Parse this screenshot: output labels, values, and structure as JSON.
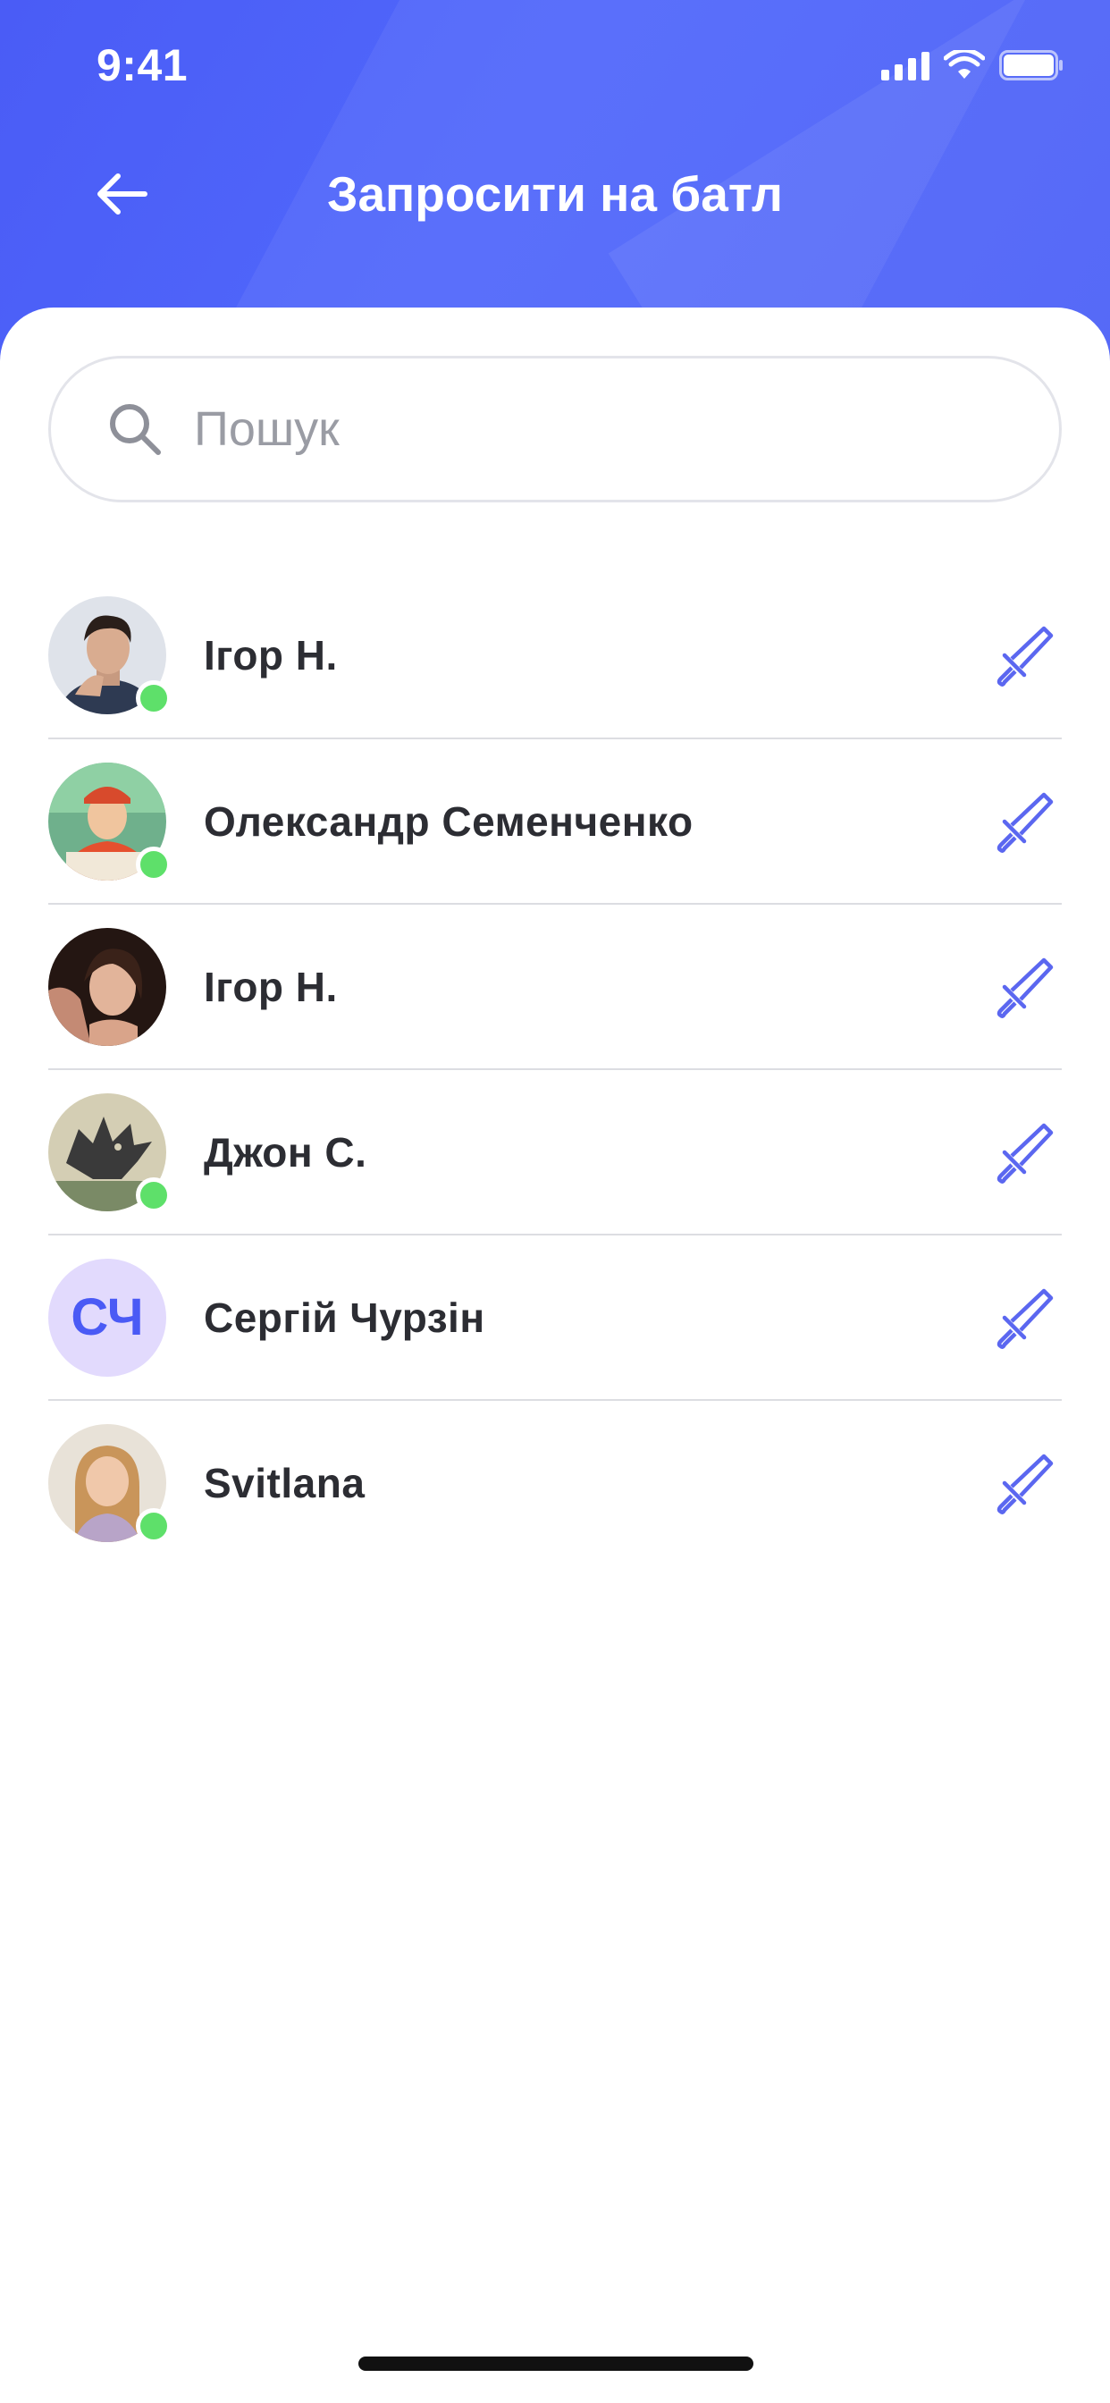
{
  "status_bar": {
    "time": "9:41"
  },
  "topbar": {
    "title": "Запросити на батл",
    "back_icon": "arrow-left-icon"
  },
  "search": {
    "placeholder": "Пошук",
    "value": "",
    "icon": "search-icon"
  },
  "colors": {
    "accent": "#4a5cf6",
    "online": "#5ee06a",
    "initials_bg": "#e2dafd"
  },
  "contacts": [
    {
      "name": "Ігор Н.",
      "online": true,
      "avatar": "photo",
      "action_icon": "sword-icon"
    },
    {
      "name": "Олександр Семенченко",
      "online": true,
      "avatar": "photo",
      "action_icon": "sword-icon"
    },
    {
      "name": "Ігор Н.",
      "online": false,
      "avatar": "photo",
      "action_icon": "sword-icon"
    },
    {
      "name": "Джон С.",
      "online": true,
      "avatar": "photo",
      "action_icon": "sword-icon"
    },
    {
      "name": "Сергій Чурзін",
      "online": false,
      "avatar": "initials",
      "initials": "СЧ",
      "action_icon": "sword-icon"
    },
    {
      "name": "Svitlana",
      "online": true,
      "avatar": "photo",
      "action_icon": "sword-icon"
    }
  ]
}
